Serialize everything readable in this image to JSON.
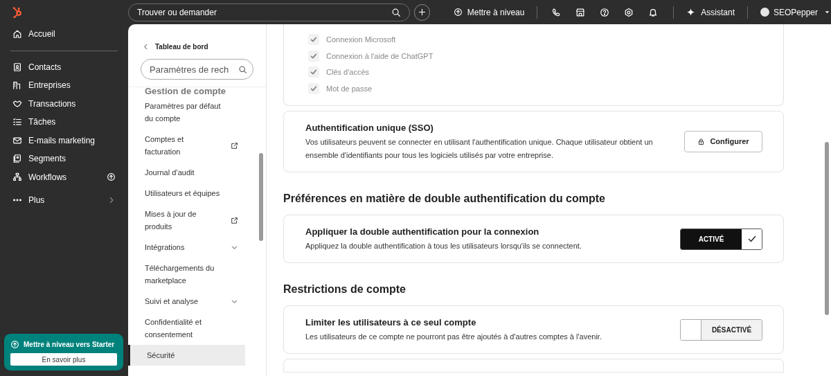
{
  "top_bar": {
    "search": {
      "placeholder": "Trouver ou demander"
    },
    "upgrade": "Mettre à niveau",
    "assistant": "Assistant",
    "account": "SEOPepper"
  },
  "nav": {
    "items": [
      {
        "label": "Accueil"
      },
      {
        "label": "Contacts"
      },
      {
        "label": "Entreprises"
      },
      {
        "label": "Transactions"
      },
      {
        "label": "Tâches"
      },
      {
        "label": "E-mails marketing"
      },
      {
        "label": "Segments"
      },
      {
        "label": "Workflows",
        "upgrade": true
      },
      {
        "label": "Plus",
        "chevron": true
      }
    ],
    "promo": {
      "title": "Mettre à niveau vers Starter",
      "button": "En savoir plus"
    }
  },
  "settings_nav": {
    "back": "Tableau de bord",
    "search": {
      "placeholder": "Paramètres de rech"
    },
    "section": "Gestion de compte",
    "items": [
      {
        "label": "Paramètres par défaut du compte",
        "kind": "plain",
        "selected": false
      },
      {
        "label": "Comptes et facturation",
        "kind": "external",
        "selected": false
      },
      {
        "label": "Journal d’audit",
        "kind": "plain",
        "selected": false
      },
      {
        "label": "Utilisateurs et équipes",
        "kind": "plain",
        "selected": false
      },
      {
        "label": "Mises à jour de produits",
        "kind": "external",
        "selected": false
      },
      {
        "label": "Intégrations",
        "kind": "expandable",
        "selected": false
      },
      {
        "label": "Téléchargements du marketplace",
        "kind": "plain",
        "selected": false
      },
      {
        "label": "Suivi et analyse",
        "kind": "expandable",
        "selected": false
      },
      {
        "label": "Confidentialité et consentement",
        "kind": "plain",
        "selected": false
      },
      {
        "label": "Sécurité",
        "kind": "plain",
        "selected": true
      }
    ]
  },
  "login_methods": [
    {
      "label": "Connexion Microsoft",
      "checked": true
    },
    {
      "label": "Connexion à l'aide de ChatGPT",
      "checked": true
    },
    {
      "label": "Clés d'accès",
      "checked": true
    },
    {
      "label": "Mot de passe",
      "checked": true
    }
  ],
  "sso": {
    "title": "Authentification unique (SSO)",
    "description": "Vos utilisateurs peuvent se connecter en utilisant l'authentification unique. Chaque utilisateur obtient un ensemble d'identifiants pour tous les logiciels utilisés par votre entreprise.",
    "button": "Configurer"
  },
  "sections": [
    {
      "heading": "Préférences en matière de double authentification du compte",
      "title": "Appliquer la double authentification pour la connexion",
      "description": "Appliquez la double authentification à tous les utilisateurs lorsqu'ils se connectent.",
      "toggle": {
        "on": true,
        "label": "ACTIVÉ"
      }
    },
    {
      "heading": "Restrictions de compte",
      "title": "Limiter les utilisateurs à ce seul compte",
      "description": "Les utilisateurs de ce compte ne pourront pas être ajoutés à d'autres comptes à l'avenir.",
      "toggle": {
        "on": false,
        "label": "DÉSACTIVÉ"
      }
    }
  ]
}
